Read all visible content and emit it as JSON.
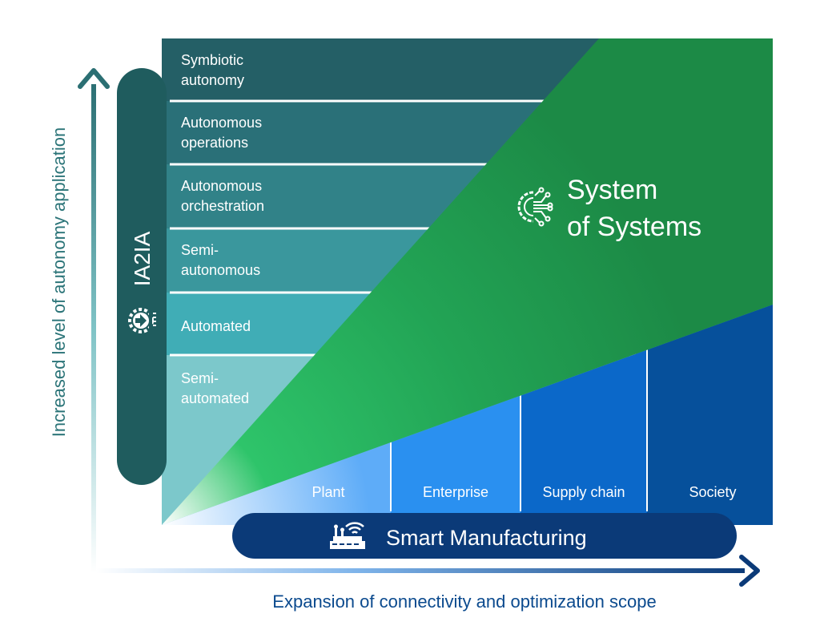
{
  "y_axis_label": "Increased level of autonomy application",
  "x_axis_label": "Expansion of connectivity and optimization scope",
  "ia2ia": {
    "label": "IA2IA",
    "icon": "gear-arrow-chip-icon",
    "color": "#1f5c5e"
  },
  "levels": [
    {
      "line1": "Symbiotic",
      "line2": "autonomy",
      "color": "#245f66"
    },
    {
      "line1": "Autonomous",
      "line2": "operations",
      "color": "#2a7078"
    },
    {
      "line1": "Autonomous",
      "line2": "orchestration",
      "color": "#318288"
    },
    {
      "line1": "Semi-",
      "line2": "autonomous",
      "color": "#3a979d"
    },
    {
      "line1": "Automated",
      "line2": "",
      "color": "#40adb6"
    },
    {
      "line1": "Semi-",
      "line2": "automated",
      "color": "#7cc8cb"
    }
  ],
  "system_of_systems": {
    "line1": "System",
    "line2": "of Systems",
    "icon": "gear-circuit-icon",
    "color": "#1e9048"
  },
  "scopes": [
    {
      "label": "Plant",
      "color": "#5eacf8"
    },
    {
      "label": "Enterprise",
      "color": "#2a90f0"
    },
    {
      "label": "Supply chain",
      "color": "#0b68c9"
    },
    {
      "label": "Society",
      "color": "#06509b"
    }
  ],
  "smart_manufacturing": {
    "label": "Smart Manufacturing",
    "icon": "factory-wifi-icon",
    "color": "#0b3a78"
  }
}
